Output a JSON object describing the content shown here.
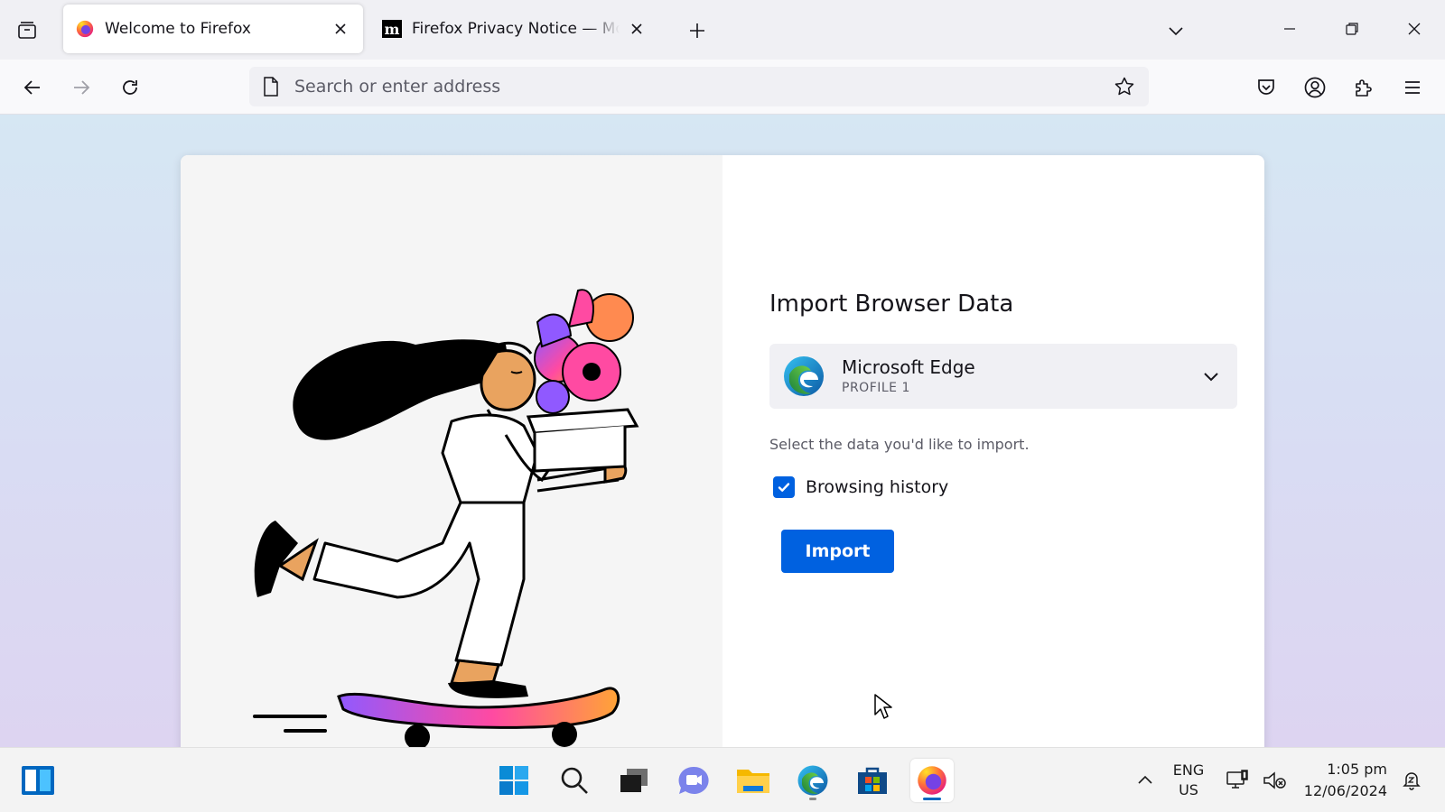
{
  "window": {
    "tabs": [
      {
        "title": "Welcome to Firefox",
        "active": true,
        "favicon": "firefox-icon"
      },
      {
        "title": "Firefox Privacy Notice — Mozilla",
        "active": false,
        "favicon": "mozilla-m-icon"
      }
    ],
    "controls": [
      "minimize-icon",
      "restore-icon",
      "close-icon"
    ]
  },
  "navbar": {
    "url_placeholder": "Search or enter address",
    "url_value": "",
    "buttons": [
      "back-icon",
      "forward-icon",
      "reload-icon",
      "bookmark-star-icon",
      "pocket-icon",
      "account-icon",
      "extensions-icon",
      "menu-icon"
    ]
  },
  "import_panel": {
    "title": "Import Browser Data",
    "browser": {
      "name": "Microsoft Edge",
      "profile": "PROFILE 1"
    },
    "helper_text": "Select the data you'd like to import.",
    "options": [
      {
        "label": "Browsing history",
        "checked": true
      }
    ],
    "import_label": "Import"
  },
  "taskbar": {
    "apps": [
      "widgets-icon",
      "windows-start-icon",
      "search-icon",
      "task-view-icon",
      "chat-icon",
      "file-explorer-icon",
      "edge-icon",
      "store-icon",
      "firefox-icon"
    ],
    "language": {
      "line1": "ENG",
      "line2": "US"
    },
    "time": "1:05 pm",
    "date": "12/06/2024"
  },
  "colors": {
    "accent": "#0061e0",
    "tab_strip": "#f0f0f4",
    "content_gradient": [
      "#d6e7f3",
      "#ddd4f1"
    ]
  }
}
